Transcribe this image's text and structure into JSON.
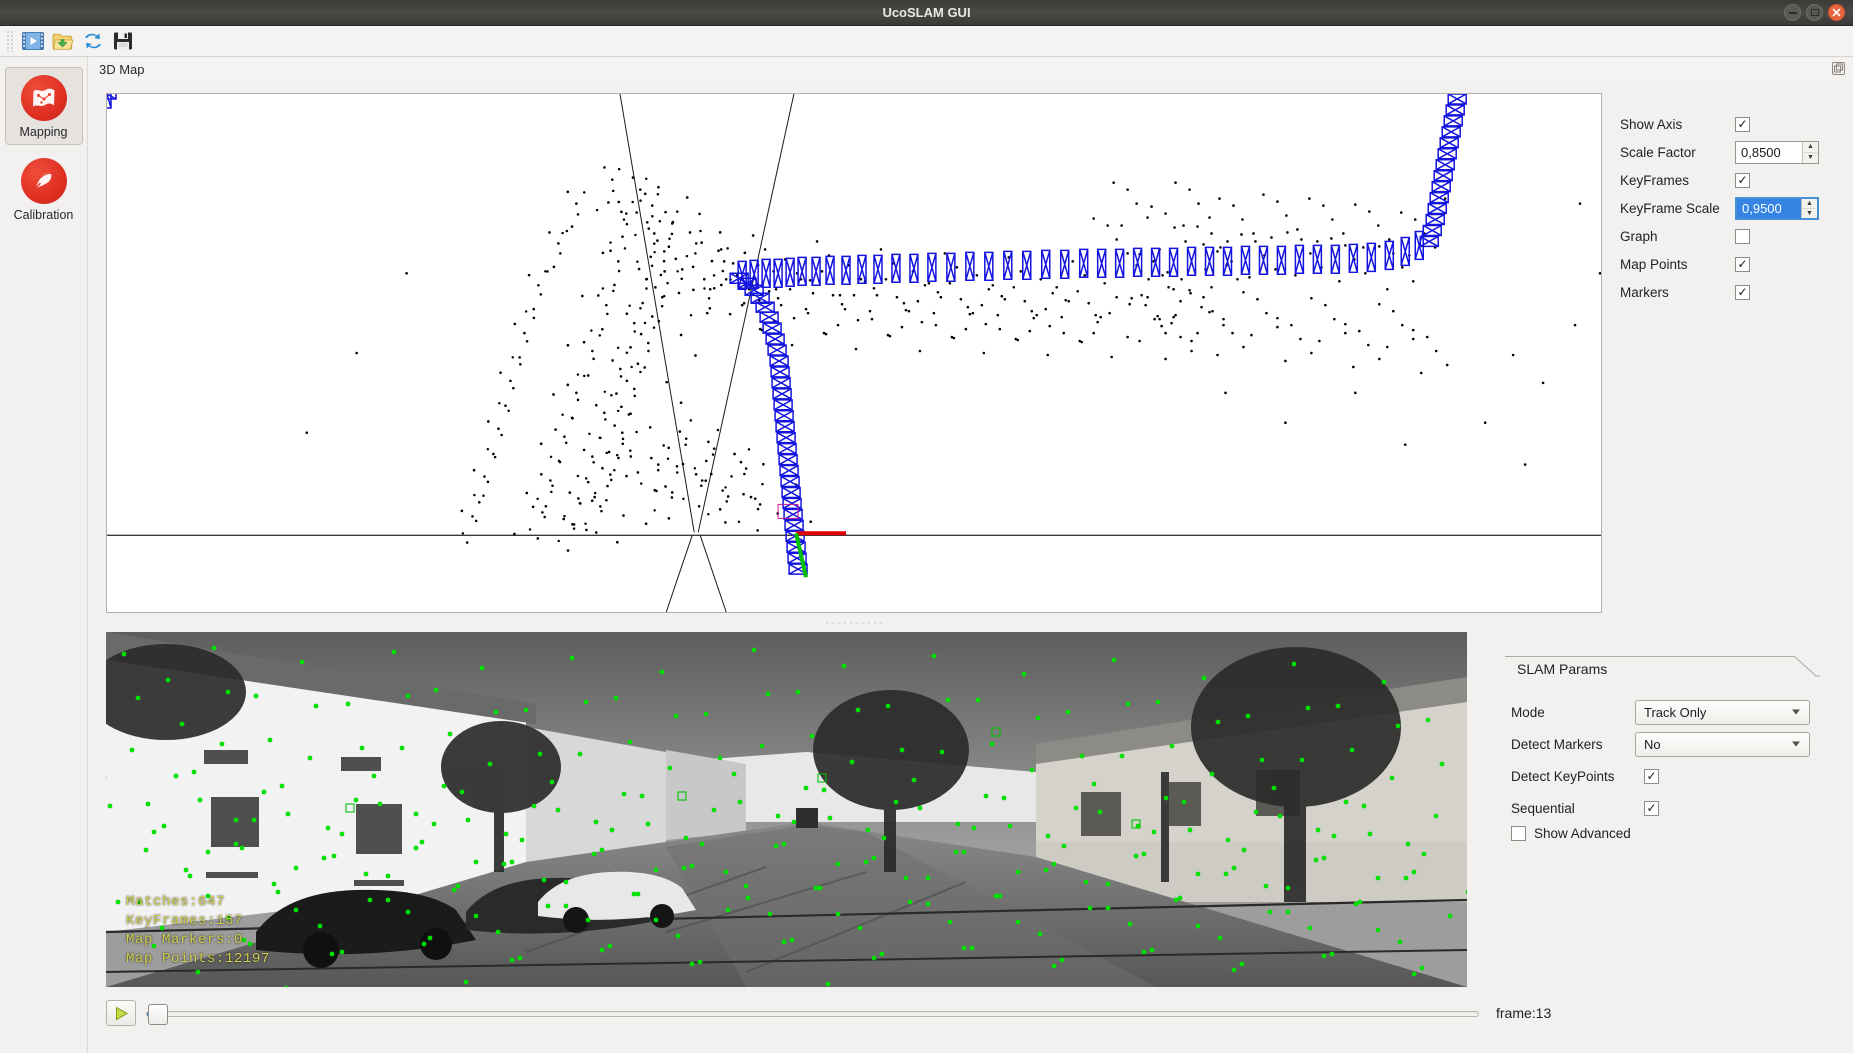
{
  "window": {
    "title": "UcoSLAM GUI",
    "controls": [
      {
        "name": "minimize",
        "glyph": "minimize-icon"
      },
      {
        "name": "maximize",
        "glyph": "maximize-icon"
      },
      {
        "name": "close",
        "glyph": "close-icon",
        "color": "#e8643c"
      }
    ]
  },
  "toolbar": {
    "buttons": [
      {
        "name": "open-video-button",
        "icon": "video-icon",
        "tooltip": "Open Video"
      },
      {
        "name": "open-folder-button",
        "icon": "folder-open-icon",
        "tooltip": "Open Sequence"
      },
      {
        "name": "reload-button",
        "icon": "refresh-icon",
        "tooltip": "Reload"
      },
      {
        "name": "save-button",
        "icon": "floppy-save-icon",
        "tooltip": "Save Map"
      }
    ]
  },
  "sidebar": {
    "items": [
      {
        "label": "Mapping",
        "icon": "map-icon",
        "selected": true
      },
      {
        "label": "Calibration",
        "icon": "calibration-wand-icon",
        "selected": false
      }
    ]
  },
  "dock": {
    "title": "3D Map",
    "float_button": "undock-icon"
  },
  "view_options": {
    "rows": [
      {
        "label": "Show Axis",
        "type": "checkbox",
        "checked": true,
        "mark": "✓"
      },
      {
        "label": "Scale Factor",
        "type": "spinbox",
        "value": "0,8500",
        "focused": false
      },
      {
        "label": "KeyFrames",
        "type": "checkbox",
        "checked": true,
        "mark": "✓"
      },
      {
        "label": "KeyFrame Scale",
        "type": "spinbox",
        "value": "0,9500",
        "focused": true
      },
      {
        "label": "Graph",
        "type": "checkbox",
        "checked": false,
        "mark": ""
      },
      {
        "label": "Map Points",
        "type": "checkbox",
        "checked": true,
        "mark": "✓"
      },
      {
        "label": "Markers",
        "type": "checkbox",
        "checked": true,
        "mark": "✓"
      }
    ],
    "spin_up": "▲",
    "spin_down": "▼"
  },
  "map_view": {
    "keyframe_color": "#1414e0",
    "point_color": "#000000",
    "axis_x_color": "#e00000",
    "axis_y_color": "#00c000",
    "background": "#ffffff"
  },
  "video": {
    "stats": [
      "Matches:647",
      "KeyFrames:157",
      "Map  Markers:0",
      "Map  Points:12197"
    ],
    "keypoint_color": "#00e000",
    "stats_color": "#cfcf4d"
  },
  "slam_params": {
    "title": "SLAM Params",
    "rows": [
      {
        "label": "Mode",
        "type": "combo",
        "value": "Track Only"
      },
      {
        "label": "Detect Markers",
        "type": "combo",
        "value": "No"
      },
      {
        "label": "Detect KeyPoints",
        "type": "checkbox",
        "checked": true,
        "mark": "✓"
      },
      {
        "label": "Sequential",
        "type": "checkbox",
        "checked": true,
        "mark": "✓"
      }
    ],
    "advanced": {
      "label": "Show Advanced",
      "checked": false,
      "mark": ""
    }
  },
  "playback": {
    "play_button": "play-icon",
    "frame_label": "frame:13",
    "slider_value": 0
  }
}
